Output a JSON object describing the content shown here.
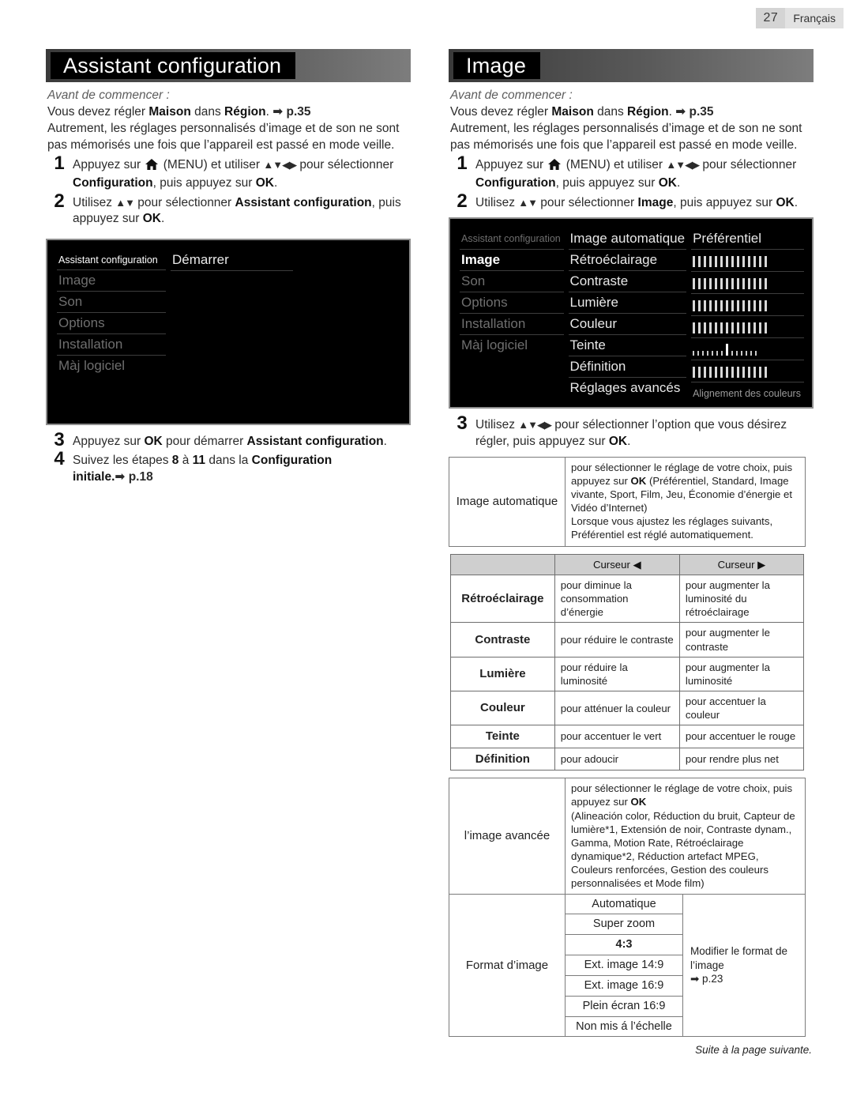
{
  "page": {
    "number": "27",
    "language": "Français"
  },
  "left": {
    "title": "Assistant configuration",
    "avant": "Avant de commencer :",
    "intro1_a": "Vous devez régler ",
    "intro1_maison": "Maison",
    "intro1_b": " dans ",
    "intro1_region": "Région",
    "intro1_c": ". ",
    "intro1_ref": "➡ p.35",
    "intro2": "Autrement, les réglages personnalisés d’image et de son ne sont pas mémorisés une fois que l’appareil est passé en mode veille.",
    "steps": [
      {
        "num": "1",
        "pre": "Appuyez sur ",
        "icon": "home-icon",
        "mid": " (MENU) et utiliser ",
        "arrows": "▲▼◀▶",
        "post": " pour sélectionner ",
        "target": "Configuration",
        "tail": ", puis appuyez sur ",
        "ok": "OK",
        "end": "."
      },
      {
        "num": "2",
        "pre": "Utilisez ",
        "arrows": "▲▼",
        "post": " pour sélectionner ",
        "target": "Assistant configuration",
        "tail": ", puis appuyez sur ",
        "ok": "OK",
        "end": "."
      }
    ],
    "tv": {
      "menu": [
        {
          "label": "Assistant configuration",
          "state": "selected"
        },
        {
          "label": "Image",
          "state": "dim"
        },
        {
          "label": "Son",
          "state": "dim"
        },
        {
          "label": "Options",
          "state": "dim"
        },
        {
          "label": "Installation",
          "state": "dim"
        },
        {
          "label": "Màj logiciel",
          "state": "dim"
        }
      ],
      "value": "Démarrer"
    },
    "steps_after": [
      {
        "num": "3",
        "pre": "Appuyez sur ",
        "ok": "OK",
        "mid": " pour démarrer ",
        "target": "Assistant configuration",
        "end": "."
      },
      {
        "num": "4",
        "pre": "Suivez les étapes ",
        "n1": "8",
        "mid1": " à ",
        "n2": "11",
        "mid2": " dans la ",
        "target": "Configuration initiale.",
        "ref": "➡ p.18"
      }
    ]
  },
  "right": {
    "title": "Image",
    "avant": "Avant de commencer :",
    "intro1_a": "Vous devez régler ",
    "intro1_maison": "Maison",
    "intro1_b": " dans ",
    "intro1_region": "Région",
    "intro1_c": ". ",
    "intro1_ref": "➡ p.35",
    "intro2": "Autrement, les réglages personnalisés d’image et de son ne sont pas mémorisés une fois que l’appareil est passé en mode veille.",
    "steps": [
      {
        "num": "1",
        "pre": "Appuyez sur ",
        "icon": "home-icon",
        "mid": " (MENU) et utiliser ",
        "arrows": "▲▼◀▶",
        "post": " pour sélectionner ",
        "target": "Configuration",
        "tail": ", puis appuyez sur ",
        "ok": "OK",
        "end": "."
      },
      {
        "num": "2",
        "pre": "Utilisez ",
        "arrows": "▲▼",
        "post": " pour sélectionner ",
        "target": "Image",
        "tail": ", puis appuyez sur ",
        "ok": "OK",
        "end": "."
      }
    ],
    "tv": {
      "menu": [
        {
          "label": "Assistant configuration",
          "state": "small-dim"
        },
        {
          "label": "Image",
          "state": "selected-bold"
        },
        {
          "label": "Son",
          "state": "dim"
        },
        {
          "label": "Options",
          "state": "dim"
        },
        {
          "label": "Installation",
          "state": "dim"
        },
        {
          "label": "Màj logiciel",
          "state": "dim"
        }
      ],
      "options": [
        {
          "label": "Image automatique",
          "value": "Préférentiel",
          "type": "text"
        },
        {
          "label": "Rétroéclairage",
          "value": "",
          "type": "slider"
        },
        {
          "label": "Contraste",
          "value": "",
          "type": "slider"
        },
        {
          "label": "Lumière",
          "value": "",
          "type": "slider"
        },
        {
          "label": "Couleur",
          "value": "",
          "type": "slider"
        },
        {
          "label": "Teinte",
          "value": "",
          "type": "slider-center"
        },
        {
          "label": "Définition",
          "value": "",
          "type": "slider"
        },
        {
          "label": "Réglages avancés",
          "value": "Alignement des couleurs",
          "type": "text-dim"
        }
      ]
    },
    "step3": {
      "num": "3",
      "pre": "Utilisez ",
      "arrows": "▲▼◀▶",
      "post": " pour sélectionner l’option que vous désirez régler, puis appuyez sur ",
      "ok": "OK",
      "end": "."
    },
    "table_auto": {
      "name": "Image automatique",
      "desc_line1": "pour sélectionner le réglage de votre choix, puis appuyez sur ",
      "desc_ok": "OK",
      "desc_line2": " (Préférentiel, Standard, Image vivante, Sport, Film, Jeu, Économie d’énergie et Vidéo d’Internet)",
      "desc_line3": "Lorsque vous ajustez les réglages suivants, Préférentiel est réglé automatiquement."
    },
    "table_curseur": {
      "headers": [
        "",
        "Curseur ◀",
        "Curseur ▶"
      ],
      "rows": [
        {
          "name": "Rétroéclairage",
          "left": "pour diminue la consommation d’énergie",
          "right": "pour augmenter la luminosité du rétroéclairage"
        },
        {
          "name": "Contraste",
          "left": "pour réduire le contraste",
          "right": "pour augmenter le contraste"
        },
        {
          "name": "Lumière",
          "left": "pour réduire la luminosité",
          "right": "pour augmenter la luminosité"
        },
        {
          "name": "Couleur",
          "left": "pour atténuer la couleur",
          "right": "pour accentuer la couleur"
        },
        {
          "name": "Teinte",
          "left": "pour accentuer le vert",
          "right": "pour accentuer le rouge"
        },
        {
          "name": "Définition",
          "left": "pour adoucir",
          "right": "pour rendre plus net"
        }
      ]
    },
    "table_avancee": {
      "name": "l’image avancée",
      "desc_line1": "pour sélectionner le réglage de votre choix, puis appuyez sur ",
      "desc_ok": "OK",
      "desc_list": "(Alineación color, Réduction du bruit, Capteur de lumière*1, Extensión de noir, Contraste dynam., Gamma, Motion Rate, Rétroéclairage dynamique*2, Réduction artefact MPEG, Couleurs renforcées, Gestion des couleurs personnalisées et Mode film)"
    },
    "table_format": {
      "name": "Format d’image",
      "options": [
        "Automatique",
        "Super zoom",
        "4:3",
        "Ext. image 14:9",
        "Ext. image 16:9",
        "Plein écran 16:9",
        "Non mis á l’échelle"
      ],
      "note": "Modifier le format de l’image",
      "note_ref": "➡ p.23"
    },
    "footer": "Suite à la page suivante."
  }
}
